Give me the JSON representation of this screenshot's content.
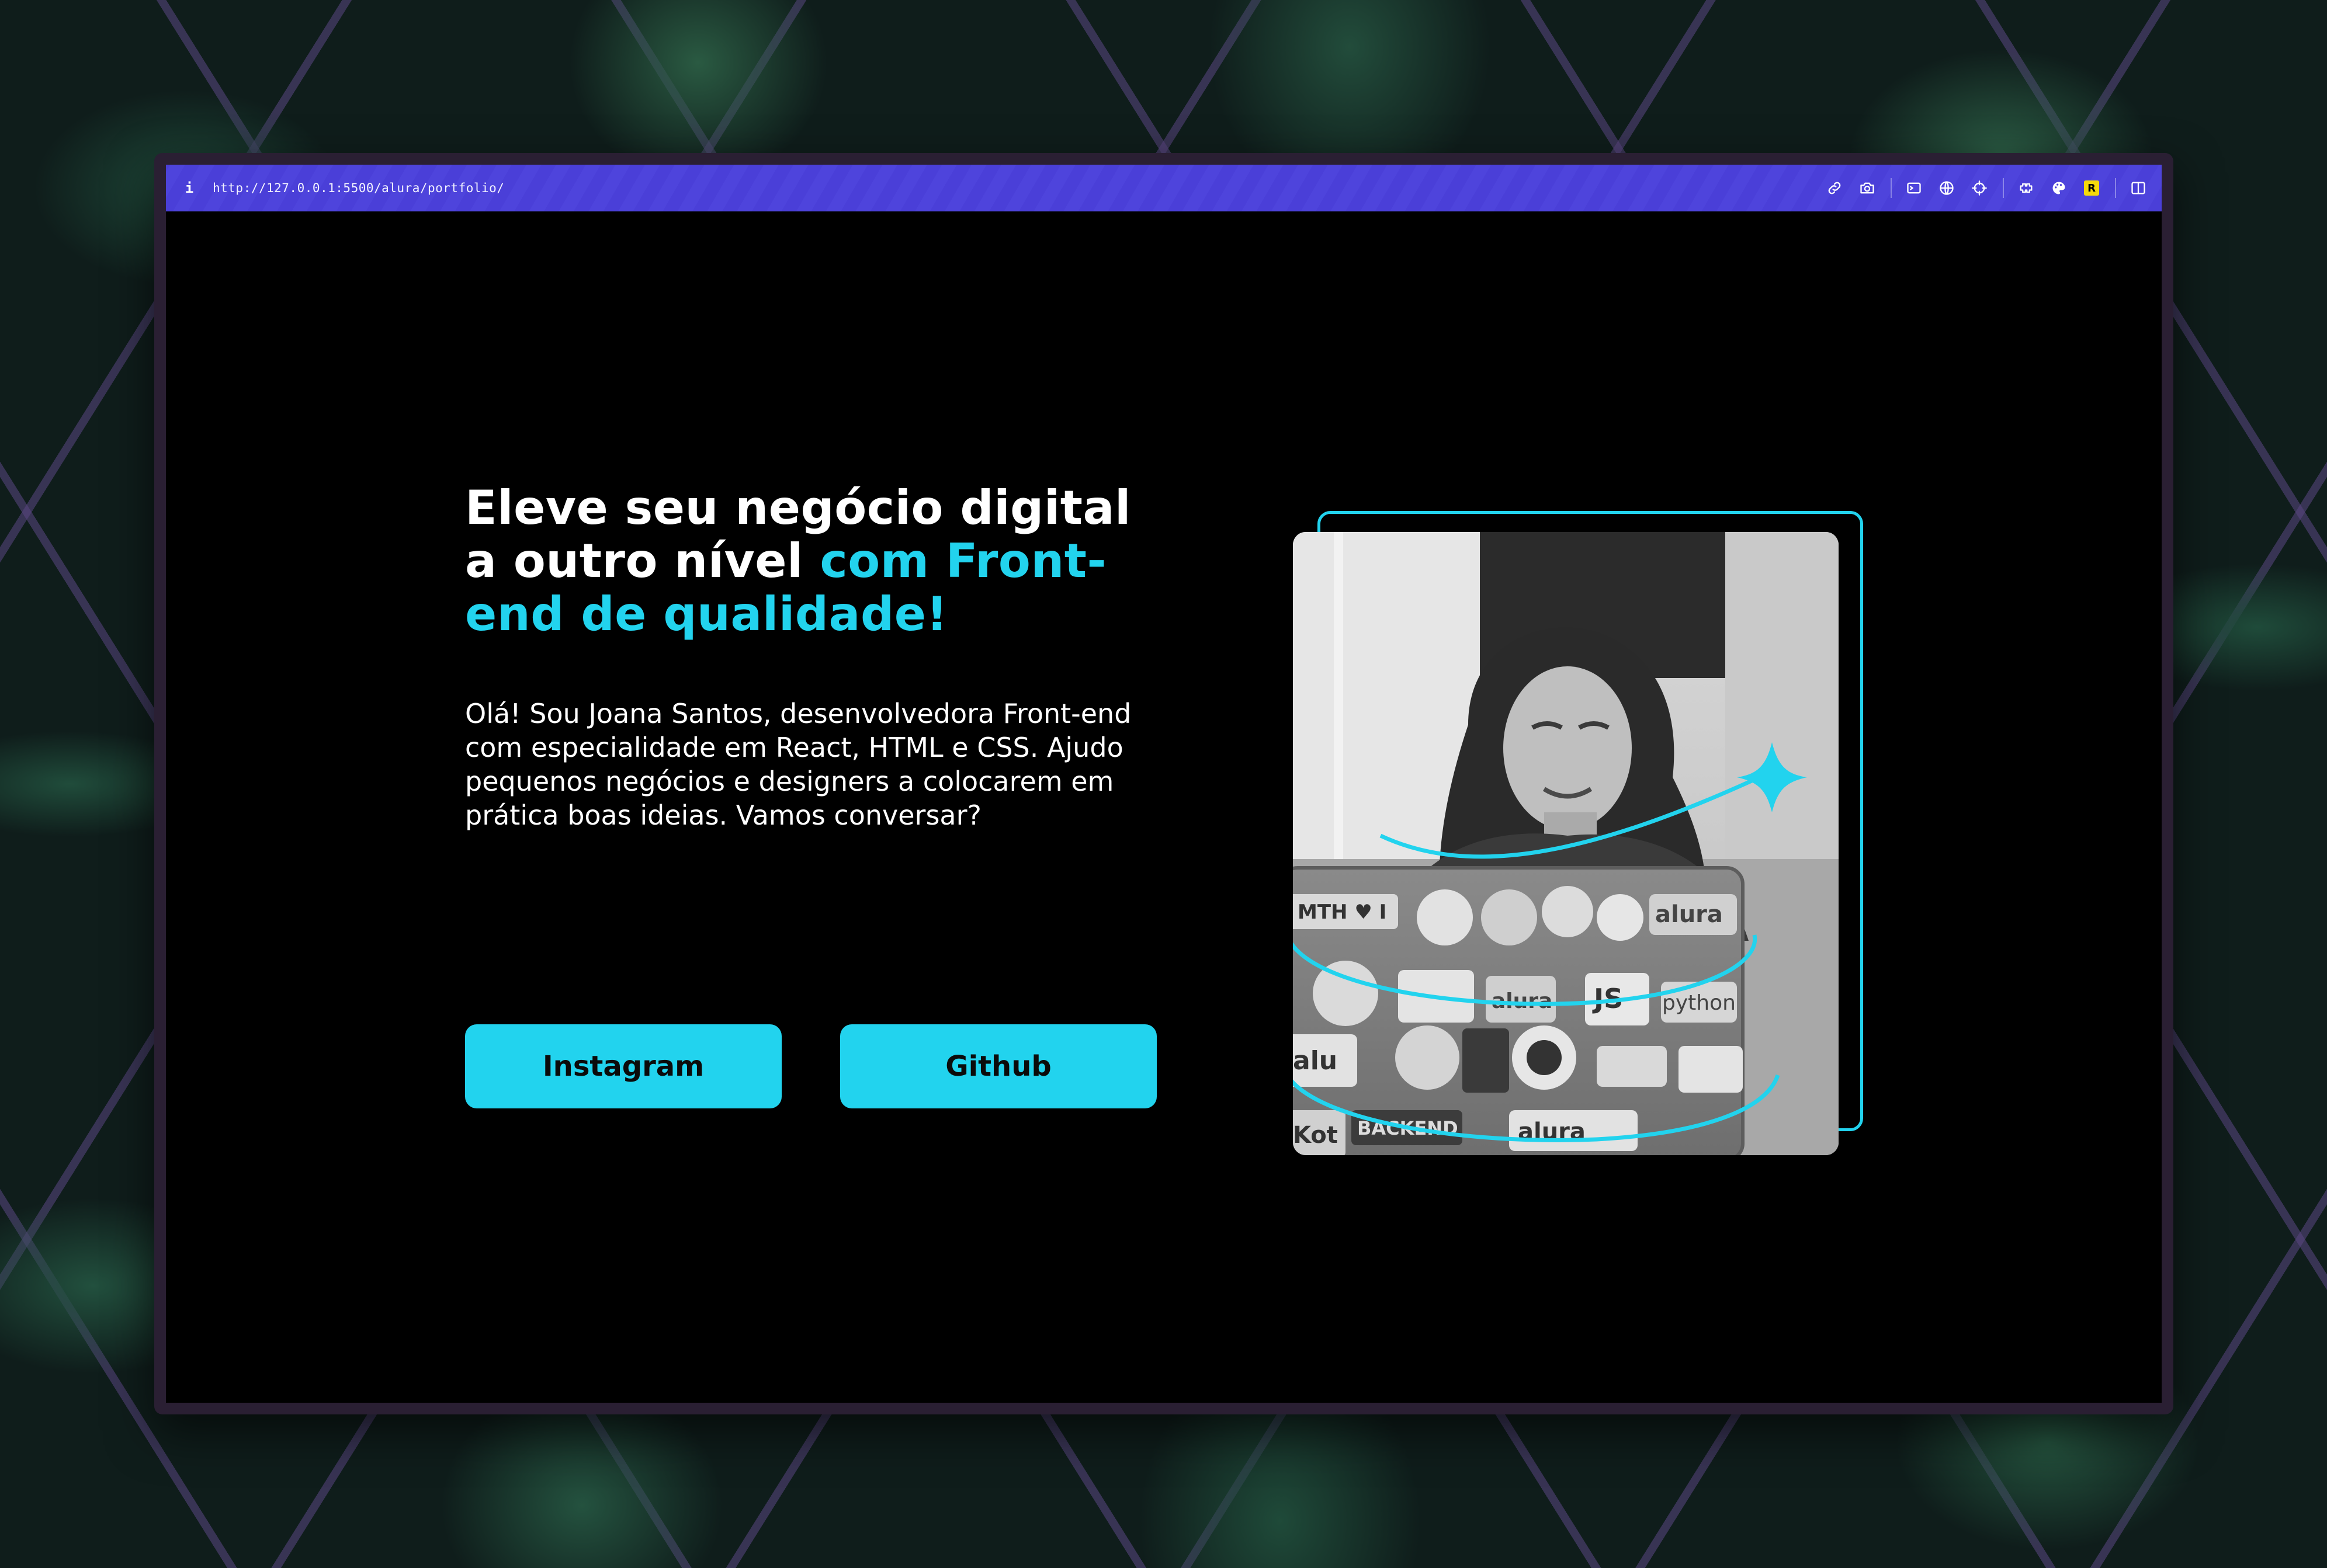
{
  "browser": {
    "info_icon": "i",
    "url": "http://127.0.0.1:5500/alura/portfolio/",
    "toolbar_icons": [
      "link-icon",
      "camera-icon",
      "terminal-icon",
      "globe-icon",
      "crosshair-icon",
      "extensions-icon",
      "color-palette-icon",
      "r-extension-icon",
      "sidebar-icon"
    ],
    "r_badge": "R",
    "accent_color": "#4a3fd8"
  },
  "hero": {
    "headline_plain": "Eleve seu negócio digital a outro nível ",
    "headline_accent": "com Front-end de qualidade!",
    "intro": "Olá! Sou Joana Santos, desenvolvedora Front-end com especialidade em React, HTML e CSS. Ajudo pequenos negócios e designers a colocarem em prática boas ideias. Vamos conversar?",
    "buttons": {
      "instagram": "Instagram",
      "github": "Github"
    },
    "accent_color": "#22d3ee",
    "photo_alt": "Joana Santos working on a laptop covered in stickers"
  },
  "photo_stickers": [
    "MTH ♥ I",
    "alura",
    "JS",
    "alura",
    "python",
    "alu",
    "BACKEND",
    "Kot",
    "alura"
  ]
}
